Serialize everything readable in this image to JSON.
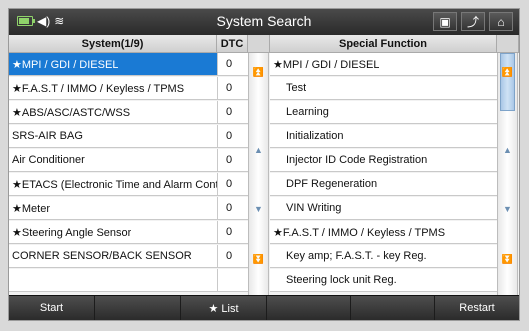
{
  "header": {
    "title": "System Search",
    "status_icons": [
      "battery-icon",
      "speaker-icon",
      "wifi-icon"
    ],
    "buttons": [
      {
        "name": "screen-icon-button",
        "glyph": "▣"
      },
      {
        "name": "back-button",
        "glyph": "⤴"
      },
      {
        "name": "home-button",
        "glyph": "⌂"
      }
    ]
  },
  "left_table": {
    "header_system": "System(1/9)",
    "header_dtc": "DTC",
    "rows": [
      {
        "label": "★MPI / GDI / DIESEL",
        "dtc": "0",
        "selected": true
      },
      {
        "label": "★F.A.S.T / IMMO / Keyless / TPMS",
        "dtc": "0",
        "selected": false
      },
      {
        "label": "★ABS/ASC/ASTC/WSS",
        "dtc": "0",
        "selected": false
      },
      {
        "label": "SRS-AIR BAG",
        "dtc": "0",
        "selected": false
      },
      {
        "label": "Air Conditioner",
        "dtc": "0",
        "selected": false
      },
      {
        "label": "★ETACS (Electronic Time and Alarm Contro",
        "dtc": "0",
        "selected": false
      },
      {
        "label": "★Meter",
        "dtc": "0",
        "selected": false
      },
      {
        "label": "★Steering Angle Sensor",
        "dtc": "0",
        "selected": false
      },
      {
        "label": "CORNER SENSOR/BACK SENSOR",
        "dtc": "0",
        "selected": false
      },
      {
        "label": "",
        "dtc": "",
        "selected": false
      }
    ]
  },
  "right_table": {
    "header": "Special Function",
    "rows": [
      {
        "label": "★MPI / GDI / DIESEL",
        "indent": false
      },
      {
        "label": "Test",
        "indent": true
      },
      {
        "label": "Learning",
        "indent": true
      },
      {
        "label": "Initialization",
        "indent": true
      },
      {
        "label": "Injector ID Code Registration",
        "indent": true
      },
      {
        "label": "DPF Regeneration",
        "indent": true
      },
      {
        "label": "VIN Writing",
        "indent": true
      },
      {
        "label": "★F.A.S.T / IMMO / Keyless / TPMS",
        "indent": false
      },
      {
        "label": "Key amp; F.A.S.T. - key Reg.",
        "indent": true
      },
      {
        "label": "Steering lock unit Reg.",
        "indent": true
      }
    ]
  },
  "scrollbar": {
    "arrows": [
      "⏫",
      "▲",
      "▲",
      "▼",
      "▼",
      "⏬"
    ]
  },
  "bottom_bar": {
    "start": "Start",
    "empty1": "",
    "list": "★ List",
    "empty2": "",
    "restart": "Restart"
  },
  "colors": {
    "selected": "#1a7ad4",
    "titlebar": "#2a2a2a",
    "accent": "#6c8fb2"
  }
}
